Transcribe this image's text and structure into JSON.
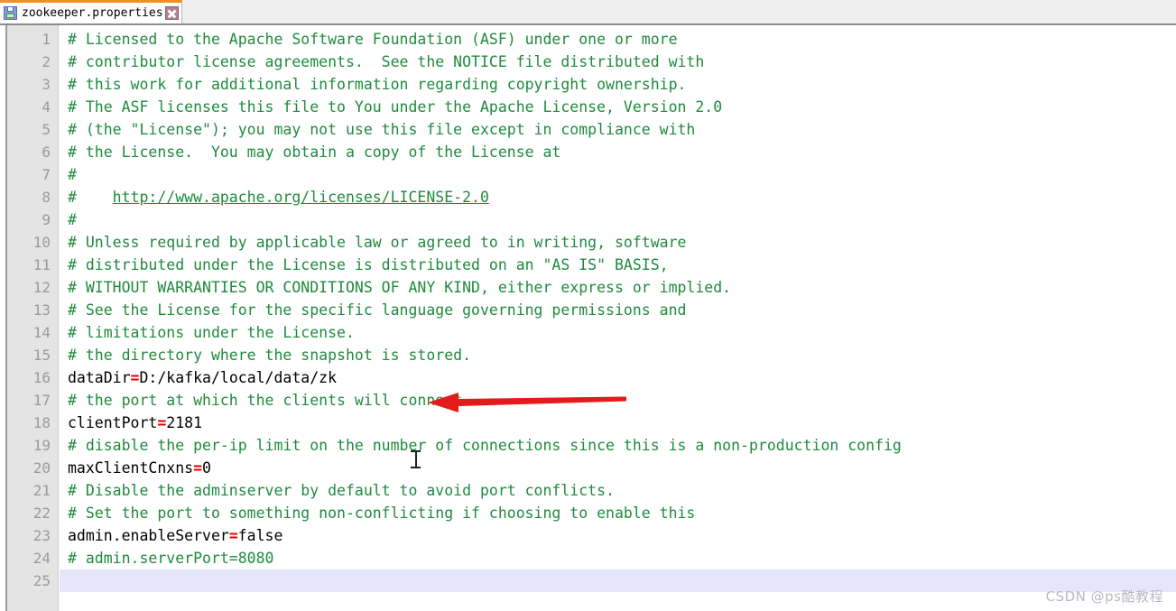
{
  "window": {
    "accent_color": "#f0901e",
    "tab_bar_bg": "#efefef"
  },
  "tab": {
    "title": "zookeeper.properties",
    "save_icon": "floppy-disk-icon",
    "close_icon": "close-icon",
    "close_label": "×"
  },
  "editor": {
    "current_line": 25,
    "current_line_highlight": "#e6e6fa",
    "comment_color": "#1f8a3d",
    "equals_color": "#e00000",
    "gutter_bg": "#e4e4e4",
    "gutter_fg": "#9a9a9a",
    "lines": [
      {
        "n": 1,
        "type": "comment",
        "text": "# Licensed to the Apache Software Foundation (ASF) under one or more"
      },
      {
        "n": 2,
        "type": "comment",
        "text": "# contributor license agreements.  See the NOTICE file distributed with"
      },
      {
        "n": 3,
        "type": "comment",
        "text": "# this work for additional information regarding copyright ownership."
      },
      {
        "n": 4,
        "type": "comment",
        "text": "# The ASF licenses this file to You under the Apache License, Version 2.0"
      },
      {
        "n": 5,
        "type": "comment",
        "text": "# (the \"License\"); you may not use this file except in compliance with"
      },
      {
        "n": 6,
        "type": "comment",
        "text": "# the License.  You may obtain a copy of the License at"
      },
      {
        "n": 7,
        "type": "comment",
        "text": "#"
      },
      {
        "n": 8,
        "type": "comment-link",
        "prefix": "#    ",
        "link": "http://www.apache.org/licenses/LICENSE-2.0"
      },
      {
        "n": 9,
        "type": "comment",
        "text": "#"
      },
      {
        "n": 10,
        "type": "comment",
        "text": "# Unless required by applicable law or agreed to in writing, software"
      },
      {
        "n": 11,
        "type": "comment",
        "text": "# distributed under the License is distributed on an \"AS IS\" BASIS,"
      },
      {
        "n": 12,
        "type": "comment",
        "text": "# WITHOUT WARRANTIES OR CONDITIONS OF ANY KIND, either express or implied."
      },
      {
        "n": 13,
        "type": "comment",
        "text": "# See the License for the specific language governing permissions and"
      },
      {
        "n": 14,
        "type": "comment",
        "text": "# limitations under the License."
      },
      {
        "n": 15,
        "type": "comment",
        "text": "# the directory where the snapshot is stored."
      },
      {
        "n": 16,
        "type": "property",
        "key": "dataDir",
        "eq": "=",
        "value": "D:/kafka/local/data/zk"
      },
      {
        "n": 17,
        "type": "comment",
        "text": "# the port at which the clients will connect"
      },
      {
        "n": 18,
        "type": "property",
        "key": "clientPort",
        "eq": "=",
        "value": "2181"
      },
      {
        "n": 19,
        "type": "comment",
        "text": "# disable the per-ip limit on the number of connections since this is a non-production config"
      },
      {
        "n": 20,
        "type": "property",
        "key": "maxClientCnxns",
        "eq": "=",
        "value": "0"
      },
      {
        "n": 21,
        "type": "comment",
        "text": "# Disable the adminserver by default to avoid port conflicts."
      },
      {
        "n": 22,
        "type": "comment",
        "text": "# Set the port to something non-conflicting if choosing to enable this"
      },
      {
        "n": 23,
        "type": "property",
        "key": "admin.enableServer",
        "eq": "=",
        "value": "false"
      },
      {
        "n": 24,
        "type": "comment",
        "text": "# admin.serverPort=8080"
      },
      {
        "n": 25,
        "type": "blank",
        "text": ""
      }
    ]
  },
  "annotation": {
    "arrow_color": "#e41b1b",
    "points_to_line": 16,
    "points_to_text": "dataDir=D:/kafka/local/data/zk"
  },
  "watermark": {
    "text": "CSDN @ps酷教程"
  }
}
